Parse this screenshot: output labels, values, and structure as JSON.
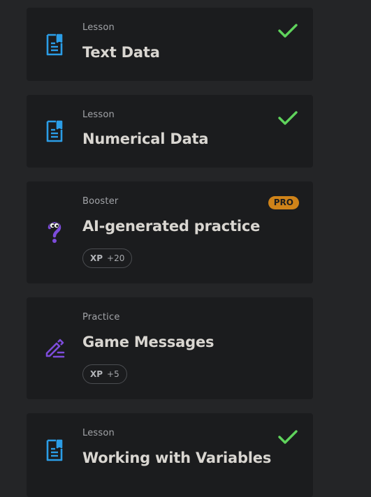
{
  "colors": {
    "background": "#242527",
    "card": "#1b1c1e",
    "lesson_icon": "#2b9de6",
    "booster_icon": "#7d4cdb",
    "practice_icon": "#7d4cdb",
    "check": "#5fd35c",
    "pro_badge": "#cf8319"
  },
  "items": [
    {
      "type": "Lesson",
      "title": "Text Data",
      "icon": "lesson-document-icon",
      "completed": true
    },
    {
      "type": "Lesson",
      "title": "Numerical Data",
      "icon": "lesson-document-icon",
      "completed": true
    },
    {
      "type": "Booster",
      "title": "AI-generated practice",
      "icon": "question-mark-character-icon",
      "badge": "PRO",
      "xp_label": "XP",
      "xp_value": "+20"
    },
    {
      "type": "Practice",
      "title": "Game Messages",
      "icon": "pencil-icon",
      "xp_label": "XP",
      "xp_value": "+5"
    },
    {
      "type": "Lesson",
      "title": "Working with Variables",
      "icon": "lesson-document-icon",
      "completed": true
    }
  ]
}
